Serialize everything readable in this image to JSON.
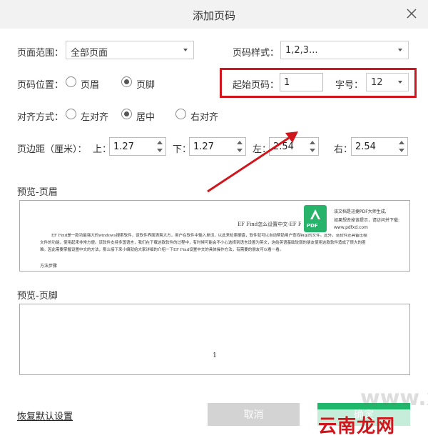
{
  "dialog": {
    "title": "添加页码"
  },
  "page_range": {
    "label": "页面范围：",
    "value": "全部页面"
  },
  "page_style": {
    "label": "页码样式：",
    "value": "1,2,3..."
  },
  "position": {
    "label": "页码位置：",
    "header": "页眉",
    "footer": "页脚",
    "selected": "footer"
  },
  "start_page": {
    "label": "起始页码：",
    "value": "1"
  },
  "font_size": {
    "label": "字号：",
    "value": "12"
  },
  "align": {
    "label": "对齐方式：",
    "left": "左对齐",
    "center": "居中",
    "right": "右对齐",
    "selected": "center"
  },
  "margins": {
    "label": "页边距（厘米）：",
    "top_label": "上：",
    "top": "1.27",
    "bottom_label": "下：",
    "bottom": "1.27",
    "left_label": "左：",
    "left": "2.54",
    "right_label": "右：",
    "right": "2.54"
  },
  "preview_header": {
    "label": "预览-页眉",
    "doc_title": "EF Find怎么设置中文-EF Find设置中文的方法",
    "para": "EF Find是一款功能强大的windows搜索软件，该软件界面清爽大方，用户在软件中输入单词，以此来检索硬盘，软件就可以自动帮助用户查找特定的文件。此外，该软件还具备压缩文件的功能，使用起来非常方便。该软件支持多国语言，我们在下载这款软件的过程中，有时候可能会不小心选择到语言设置为英文，这给英语基础较弱的朋友使用这款软件造成了很大的困难。因此需要掌握设置中文的方法，那么接下来小编就给大家详细的介绍一下EF Find设置中文的具体操作方法，有需要的朋友可以看一看。",
    "method": "方法步骤",
    "pdf_logo": "PDF",
    "promo_1": "该文档是迅捷PDF大师生成,",
    "promo_2": "如果想去掉该提示，请访问并下载:",
    "promo_3": "www.pdfxd.com"
  },
  "preview_footer": {
    "label": "预览-页脚",
    "page_number": "1"
  },
  "buttons": {
    "restore": "恢复默认设置",
    "cancel": "取消",
    "ok": "确定"
  },
  "watermark": {
    "text": "云南龙网",
    "subtext": "www.xiazaiba.com"
  },
  "colors": {
    "accent": "#1fb76a",
    "highlight_box": "#d0161c",
    "cancel_bg": "#d3d3d3",
    "pdf_logo": "#27b36a"
  },
  "icons": {
    "close": "close-icon",
    "pdf": "pdf-logo-icon",
    "arrow": "annotation-arrow"
  }
}
